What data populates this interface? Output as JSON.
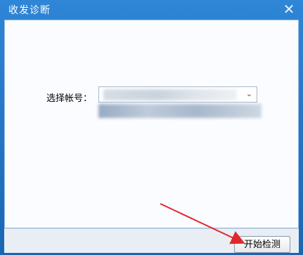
{
  "window": {
    "title": "收发诊断"
  },
  "titlebar": {
    "close_icon": "close-icon"
  },
  "form": {
    "account_label": "选择帐号：",
    "account_select_value": "",
    "chevron_icon": "chevron-down-icon"
  },
  "footer": {
    "start_button_label": "开始检测"
  },
  "colors": {
    "titlebar": "#1f6fbe",
    "content_bg": "#fbfcff",
    "annotation_arrow": "#e0282c"
  }
}
